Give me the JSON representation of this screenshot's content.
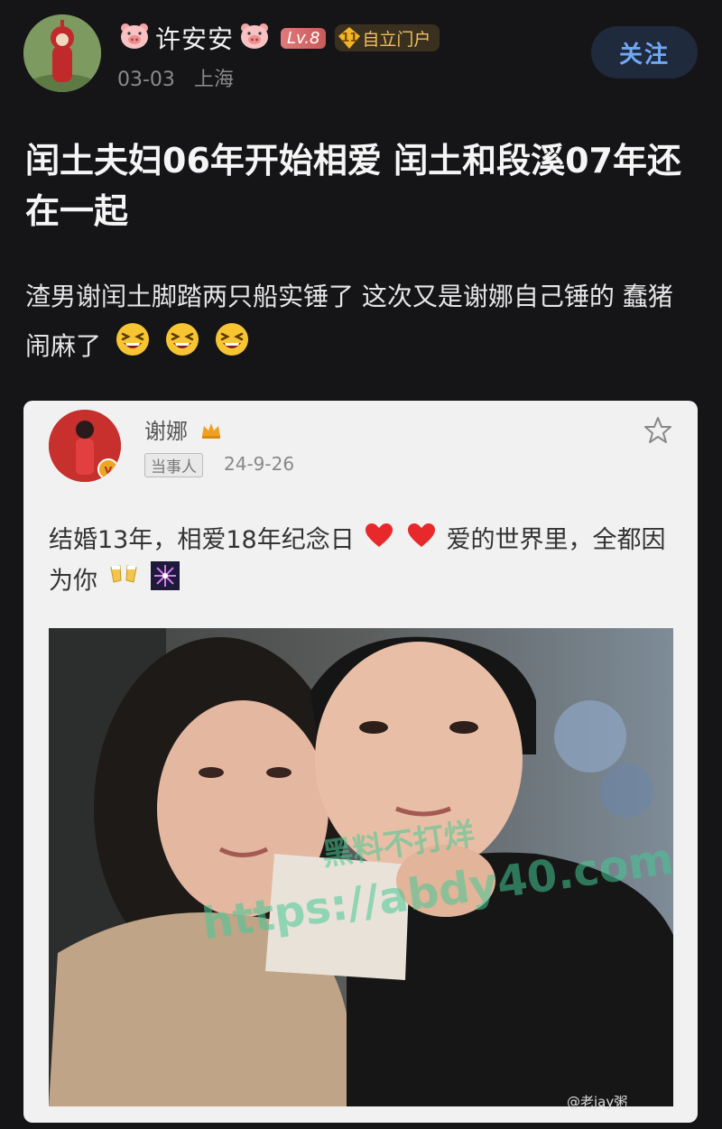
{
  "post": {
    "author": {
      "name": "许安安",
      "level": "Lv.8",
      "fan_badge_level": "11",
      "fan_badge_label": "自立门户",
      "date": "03-03",
      "location": "上海"
    },
    "follow_label": "关注",
    "title": "闰土夫妇06年开始相爱 闰土和段溪07年还在一起",
    "body": "渣男谢闰土脚踏两只船实锤了 这次又是谢娜自己锤的 蠢猪闹麻了"
  },
  "quoted": {
    "author": "谢娜",
    "tag": "当事人",
    "date": "24-9-26",
    "text_part1": "结婚13年，相爱18年纪念日",
    "text_part2": "爱的世界里，全都因为你"
  },
  "watermark": {
    "line1": "黑料不打烊",
    "line2": "https://abdy40.com"
  },
  "corner_mark": "@老jay粥"
}
